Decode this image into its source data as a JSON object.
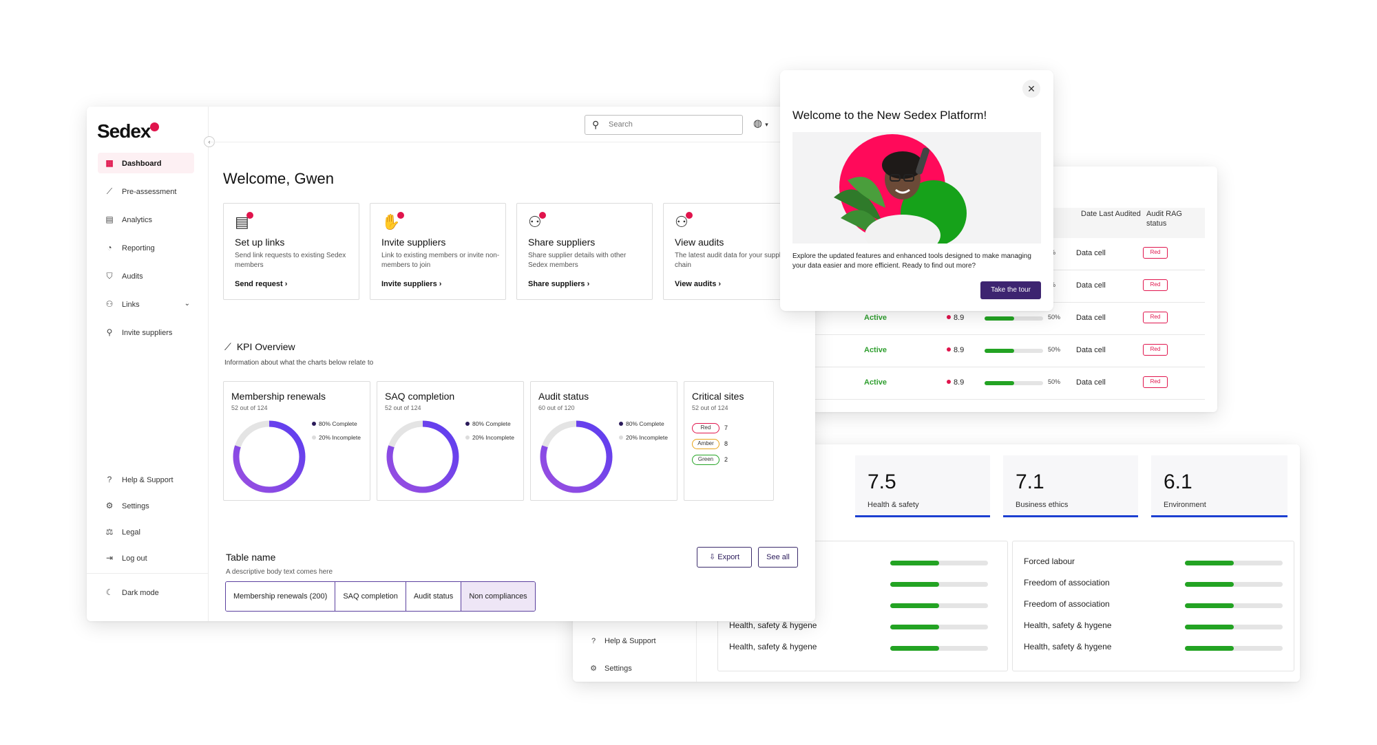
{
  "table_panel": {
    "headers": {
      "date_last": "Date Last Audited",
      "rag": "Audit RAG status"
    },
    "rows": [
      {
        "status": "",
        "score": "",
        "progress": 0.5,
        "pct": "50%",
        "cell": "Data cell",
        "rag": "Red"
      },
      {
        "status": "",
        "score": "",
        "progress": 0.5,
        "pct": "50%",
        "cell": "Data cell",
        "rag": "Red"
      },
      {
        "status": "Active",
        "score": "8.9",
        "progress": 0.5,
        "pct": "50%",
        "cell": "Data cell",
        "rag": "Red"
      },
      {
        "status": "Active",
        "score": "8.9",
        "progress": 0.5,
        "pct": "50%",
        "cell": "Data cell",
        "rag": "Red"
      },
      {
        "status": "Active",
        "score": "8.9",
        "progress": 0.5,
        "pct": "50%",
        "cell": "Data cell",
        "rag": "Red"
      }
    ]
  },
  "scores_panel": {
    "cards": [
      {
        "value": "7.5",
        "label": "Health & safety"
      },
      {
        "value": "7.1",
        "label": "Business ethics"
      },
      {
        "value": "6.1",
        "label": "Environment"
      }
    ],
    "left_rows": [
      {
        "name": "",
        "progress": 0.5
      },
      {
        "name": "",
        "progress": 0.5
      },
      {
        "name": "",
        "progress": 0.5
      },
      {
        "name": "Health, safety & hygene",
        "progress": 0.5
      },
      {
        "name": "Health, safety & hygene",
        "progress": 0.5
      }
    ],
    "right_rows": [
      {
        "name": "Forced labour",
        "progress": 0.5
      },
      {
        "name": "Freedom of association",
        "progress": 0.5
      },
      {
        "name": "Freedom of association",
        "progress": 0.5
      },
      {
        "name": "Health, safety & hygene",
        "progress": 0.5
      },
      {
        "name": "Health, safety & hygene",
        "progress": 0.5
      }
    ],
    "sidebar": {
      "help": "Help & Support",
      "settings": "Settings"
    }
  },
  "main": {
    "logo": "Sedex",
    "nav": {
      "dashboard": "Dashboard",
      "pre_assessment": "Pre-assessment",
      "analytics": "Analytics",
      "reporting": "Reporting",
      "audits": "Audits",
      "links": "Links",
      "invite": "Invite suppliers",
      "help": "Help & Support",
      "settings": "Settings",
      "legal": "Legal",
      "logout": "Log out",
      "dark": "Dark mode"
    },
    "search_placeholder": "Search",
    "welcome": "Welcome, Gwen",
    "quick_cards": [
      {
        "title": "Set up links",
        "desc": "Send link requests to existing Sedex members",
        "link": "Send request"
      },
      {
        "title": "Invite suppliers",
        "desc": "Link to existing members or invite non-members to join",
        "link": "Invite suppliers"
      },
      {
        "title": "Share suppliers",
        "desc": "Share supplier details with other Sedex members",
        "link": "Share suppliers"
      },
      {
        "title": "View audits",
        "desc": "The latest audit data for your supply chain",
        "link": "View audits"
      }
    ],
    "kpi": {
      "title": "KPI Overview",
      "subtitle": "Information about what the charts below relate to"
    },
    "table": {
      "name": "Table name",
      "desc": "A descriptive body text comes here",
      "export": "Export",
      "see_all": "See all",
      "tabs": [
        "Membership renewals (200)",
        "SAQ completion",
        "Audit status",
        "Non compliances"
      ]
    }
  },
  "chart_data": [
    {
      "type": "pie",
      "title": "Membership renewals",
      "subtitle": "52 out of 124",
      "labels": [
        "80% Complete",
        "20% Incomplete"
      ],
      "values": [
        80,
        20
      ]
    },
    {
      "type": "pie",
      "title": "SAQ completion",
      "subtitle": "52 out of 124",
      "labels": [
        "80% Complete",
        "20% Incomplete"
      ],
      "values": [
        80,
        20
      ]
    },
    {
      "type": "pie",
      "title": "Audit status",
      "subtitle": "60 out of 120",
      "labels": [
        "80% Complete",
        "20% Incomplete"
      ],
      "values": [
        80,
        20
      ]
    },
    {
      "type": "table",
      "title": "Critical sites",
      "subtitle": "52 out of 124",
      "labels": [
        "Red",
        "Amber",
        "Green"
      ],
      "values": [
        7,
        8,
        2
      ]
    }
  ],
  "modal": {
    "title": "Welcome to the New Sedex Platform!",
    "text": "Explore the updated features and enhanced tools designed to make managing your data easier and more efficient. Ready to find out more?",
    "button": "Take the tour"
  },
  "colors": {
    "brand": "#e0144c",
    "accent": "#3d2470",
    "green": "#23a323",
    "donut_start": "#9b4fe0",
    "donut_end": "#5b3df0",
    "amber": "#e8a317"
  }
}
